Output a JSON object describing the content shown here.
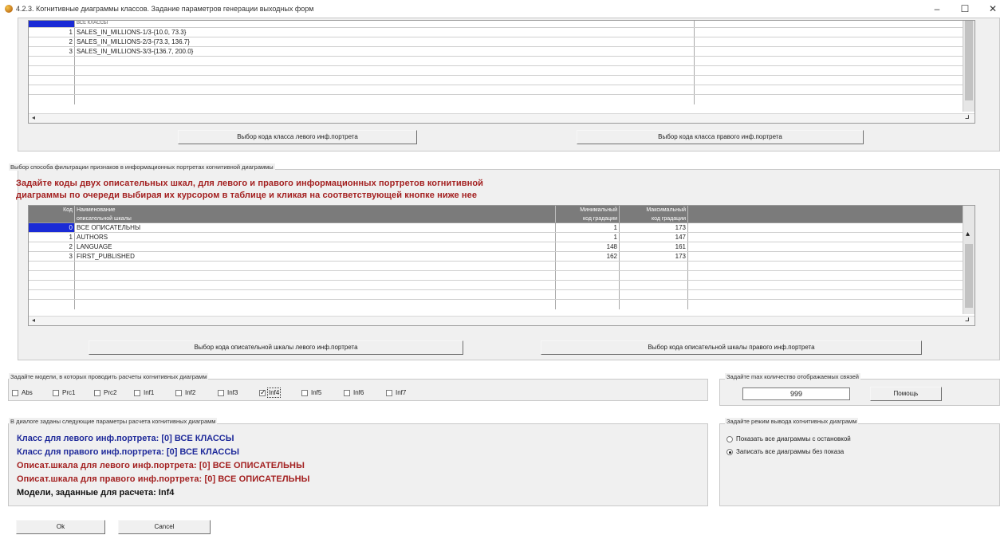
{
  "window": {
    "title": "4.2.3. Когнитивные диаграммы классов. Задание параметров генерации выходных форм",
    "minimize": "–",
    "maximize": "☐",
    "close": "✕"
  },
  "classes_grid": {
    "partial_top_text": "ВСЕ КЛАССЫ",
    "rows": [
      {
        "code": "1",
        "name": "SALES_IN_MILLIONS-1/3-{10.0, 73.3}"
      },
      {
        "code": "2",
        "name": "SALES_IN_MILLIONS-2/3-{73.3, 136.7}"
      },
      {
        "code": "3",
        "name": "SALES_IN_MILLIONS-3/3-{136.7, 200.0}"
      }
    ],
    "btn_left": "Выбор кода класса левого инф.портрета",
    "btn_right": "Выбор кода класса правого инф.портрета"
  },
  "filter_group": {
    "label": "Выбор способа фильтрации признаков в информационных портретах когнитивной диаграммы",
    "instruction_line1": "Задайте коды двух описательных шкал, для левого и правого информационных портретов когнитивной",
    "instruction_line2": "диаграммы по очереди выбирая их курсором в таблице и кликая на соответствующей кнопке ниже нее",
    "headers": {
      "code": "Код",
      "name_line1": "Наименование",
      "name_line2": "описательной шкалы",
      "min_line1": "Минимальный",
      "min_line2": "код градации",
      "max_line1": "Максимальный",
      "max_line2": "код градации"
    },
    "rows": [
      {
        "code": "0",
        "name": "ВСЕ ОПИСАТЕЛЬНЫ",
        "min": "1",
        "max": "173"
      },
      {
        "code": "1",
        "name": "AUTHORS",
        "min": "1",
        "max": "147"
      },
      {
        "code": "2",
        "name": "LANGUAGE",
        "min": "148",
        "max": "161"
      },
      {
        "code": "3",
        "name": "FIRST_PUBLISHED",
        "min": "162",
        "max": "173"
      }
    ],
    "btn_left": "Выбор кода описательной шкалы левого инф.портрета",
    "btn_right": "Выбор кода описательной шкалы правого инф.портрета"
  },
  "models_group": {
    "label": "Задайте модели, в которых проводить расчеты когнитивных диаграмм",
    "items": [
      {
        "label": "Abs",
        "checked": false
      },
      {
        "label": "Prc1",
        "checked": false
      },
      {
        "label": "Prc2",
        "checked": false
      },
      {
        "label": "Inf1",
        "checked": false
      },
      {
        "label": "Inf2",
        "checked": false
      },
      {
        "label": "Inf3",
        "checked": false
      },
      {
        "label": "Inf4",
        "checked": true
      },
      {
        "label": "Inf5",
        "checked": false
      },
      {
        "label": "Inf6",
        "checked": false
      },
      {
        "label": "Inf7",
        "checked": false
      }
    ]
  },
  "max_links_group": {
    "label": "Задайте max количество отображаемых связей",
    "value": "999",
    "help_button": "Помощь"
  },
  "summary_group": {
    "label": "В диалоге заданы следующие параметры расчета когнитивных диаграмм",
    "line1": "Класс для левого инф.портрета:  [0] ВСЕ КЛАССЫ",
    "line2": "Класс для правого инф.портрета: [0] ВСЕ КЛАССЫ",
    "line3": "Описат.шкала для левого инф.портрета:  [0] ВСЕ ОПИСАТЕЛЬНЫ",
    "line4": "Описат.шкала для правого инф.портрета: [0] ВСЕ ОПИСАТЕЛЬНЫ",
    "line5": "Модели, заданные для расчета: Inf4"
  },
  "output_mode_group": {
    "label": "Задайте режим вывода когнитивных диаграмм",
    "option1": "Показать все диаграммы с остановкой",
    "option2": "Записать все диаграммы без показа",
    "selected": 2
  },
  "footer": {
    "ok": "Ok",
    "cancel": "Cancel"
  }
}
